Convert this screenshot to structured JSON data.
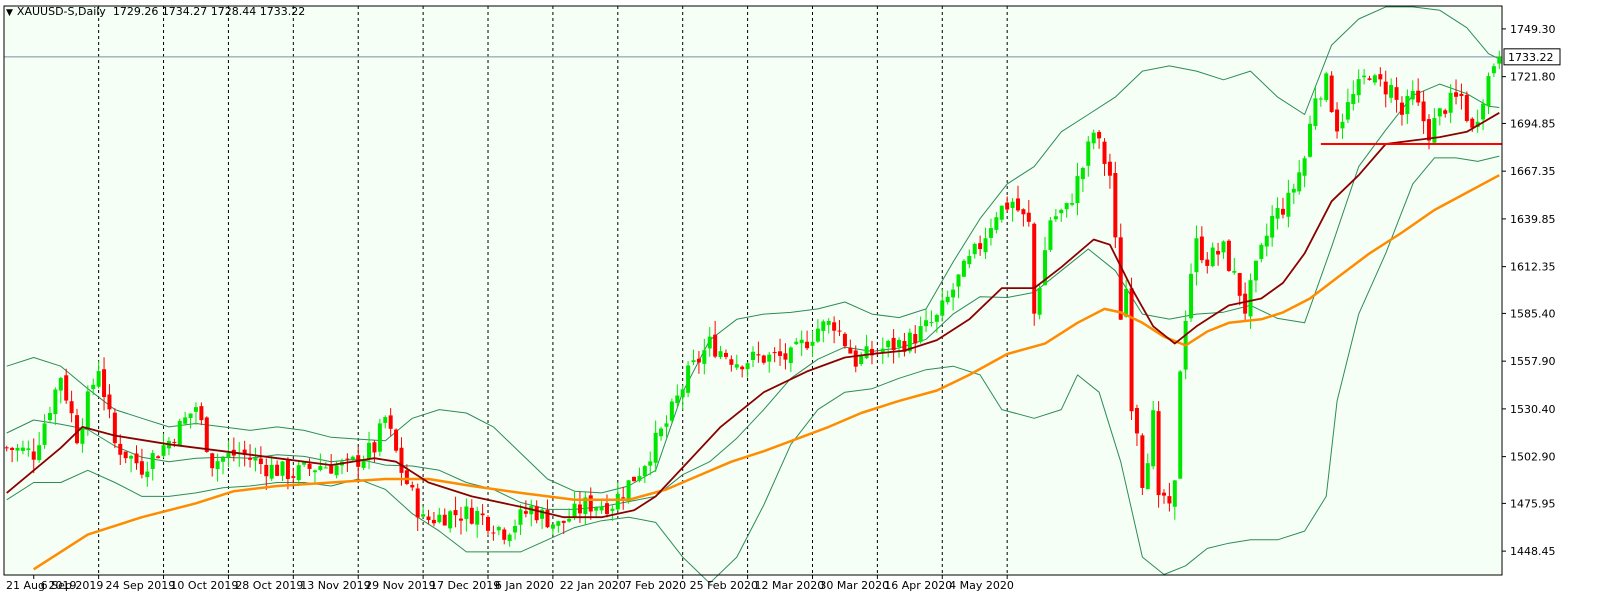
{
  "header": {
    "symbol": "XAUUSD-S,Daily",
    "ohlc": "1729.26 1734.27 1728.44 1733.22"
  },
  "colors": {
    "background": "#f5fff5",
    "bull": "#00e600",
    "bear": "#ff0000",
    "ma_fast": "#8b0000",
    "ma_slow": "#ff8c00",
    "bands": "#2e8b57",
    "grid": "#000000",
    "hline": "#7a8fa8",
    "support": "#ff0000"
  },
  "chart_data": {
    "type": "candlestick",
    "symbol": "XAUUSD-S",
    "timeframe": "Daily",
    "current_price": 1733.22,
    "price_label": "1733.22",
    "ylim": [
      1434.7,
      1762.5
    ],
    "y_ticks": [
      "1749.30",
      "1721.80",
      "1694.85",
      "1667.35",
      "1639.85",
      "1612.35",
      "1585.40",
      "1557.90",
      "1530.40",
      "1502.90",
      "1475.95",
      "1448.45"
    ],
    "x_labels": [
      "21 Aug 2019",
      "6 Sep 2019",
      "24 Sep 2019",
      "10 Oct 2019",
      "28 Oct 2019",
      "13 Nov 2019",
      "29 Nov 2019",
      "17 Dec 2019",
      "6 Jan 2020",
      "22 Jan 2020",
      "7 Feb 2020",
      "25 Feb 2020",
      "12 Mar 2020",
      "30 Mar 2020",
      "16 Apr 2020",
      "4 May 2020"
    ],
    "close_anchors": [
      [
        0,
        1508
      ],
      [
        5,
        1505
      ],
      [
        10,
        1550
      ],
      [
        13,
        1515
      ],
      [
        17,
        1555
      ],
      [
        20,
        1510
      ],
      [
        25,
        1497
      ],
      [
        30,
        1512
      ],
      [
        35,
        1532
      ],
      [
        38,
        1500
      ],
      [
        43,
        1505
      ],
      [
        48,
        1497
      ],
      [
        53,
        1493
      ],
      [
        58,
        1498
      ],
      [
        63,
        1497
      ],
      [
        68,
        1508
      ],
      [
        70,
        1525
      ],
      [
        73,
        1495
      ],
      [
        77,
        1466
      ],
      [
        82,
        1470
      ],
      [
        87,
        1470
      ],
      [
        92,
        1460
      ],
      [
        97,
        1473
      ],
      [
        102,
        1463
      ],
      [
        107,
        1475
      ],
      [
        112,
        1476
      ],
      [
        117,
        1495
      ],
      [
        122,
        1522
      ],
      [
        126,
        1550
      ],
      [
        130,
        1568
      ],
      [
        135,
        1558
      ],
      [
        140,
        1560
      ],
      [
        145,
        1560
      ],
      [
        150,
        1577
      ],
      [
        153,
        1580
      ],
      [
        157,
        1558
      ],
      [
        162,
        1565
      ],
      [
        167,
        1570
      ],
      [
        172,
        1582
      ],
      [
        176,
        1605
      ],
      [
        180,
        1625
      ],
      [
        183,
        1644
      ],
      [
        186,
        1650
      ],
      [
        188,
        1640
      ],
      [
        189,
        1636
      ],
      [
        190,
        1585
      ],
      [
        193,
        1640
      ],
      [
        196,
        1645
      ],
      [
        199,
        1670
      ],
      [
        201,
        1690
      ],
      [
        204,
        1665
      ],
      [
        206,
        1585
      ],
      [
        207,
        1600
      ],
      [
        208,
        1535
      ],
      [
        209,
        1520
      ],
      [
        210,
        1490
      ],
      [
        211,
        1505
      ],
      [
        212,
        1525
      ],
      [
        213,
        1475
      ],
      [
        214,
        1480
      ],
      [
        215,
        1470
      ],
      [
        216,
        1485
      ],
      [
        217,
        1555
      ],
      [
        218,
        1585
      ],
      [
        219,
        1610
      ],
      [
        220,
        1625
      ],
      [
        222,
        1617
      ],
      [
        225,
        1622
      ],
      [
        228,
        1598
      ],
      [
        229,
        1588
      ],
      [
        231,
        1610
      ],
      [
        234,
        1640
      ],
      [
        237,
        1650
      ],
      [
        240,
        1675
      ],
      [
        242,
        1712
      ],
      [
        244,
        1718
      ],
      [
        246,
        1694
      ],
      [
        249,
        1710
      ],
      [
        252,
        1725
      ],
      [
        253,
        1718
      ],
      [
        256,
        1715
      ],
      [
        258,
        1700
      ],
      [
        260,
        1710
      ],
      [
        263,
        1690
      ],
      [
        266,
        1705
      ],
      [
        269,
        1710
      ],
      [
        271,
        1690
      ],
      [
        273,
        1712
      ],
      [
        275,
        1730
      ],
      [
        276,
        1733.22
      ]
    ],
    "ma_fast": [
      [
        0,
        1482
      ],
      [
        10,
        1508
      ],
      [
        14,
        1520
      ],
      [
        20,
        1515
      ],
      [
        30,
        1510
      ],
      [
        40,
        1506
      ],
      [
        50,
        1502
      ],
      [
        60,
        1498
      ],
      [
        68,
        1502
      ],
      [
        72,
        1500
      ],
      [
        78,
        1488
      ],
      [
        86,
        1480
      ],
      [
        95,
        1474
      ],
      [
        103,
        1468
      ],
      [
        110,
        1468
      ],
      [
        116,
        1472
      ],
      [
        120,
        1480
      ],
      [
        126,
        1500
      ],
      [
        132,
        1520
      ],
      [
        140,
        1540
      ],
      [
        148,
        1552
      ],
      [
        155,
        1560
      ],
      [
        160,
        1562
      ],
      [
        166,
        1564
      ],
      [
        172,
        1570
      ],
      [
        178,
        1582
      ],
      [
        184,
        1600
      ],
      [
        190,
        1600
      ],
      [
        195,
        1612
      ],
      [
        201,
        1628
      ],
      [
        204,
        1625
      ],
      [
        208,
        1600
      ],
      [
        212,
        1578
      ],
      [
        216,
        1568
      ],
      [
        220,
        1578
      ],
      [
        226,
        1590
      ],
      [
        232,
        1594
      ],
      [
        236,
        1603
      ],
      [
        240,
        1620
      ],
      [
        245,
        1650
      ],
      [
        250,
        1665
      ],
      [
        255,
        1683
      ],
      [
        260,
        1685
      ],
      [
        265,
        1687
      ],
      [
        270,
        1690
      ],
      [
        276,
        1701
      ]
    ],
    "ma_slow": [
      [
        5,
        1438
      ],
      [
        15,
        1458
      ],
      [
        25,
        1468
      ],
      [
        35,
        1476
      ],
      [
        42,
        1483
      ],
      [
        50,
        1486
      ],
      [
        60,
        1488
      ],
      [
        70,
        1490
      ],
      [
        78,
        1490
      ],
      [
        86,
        1486
      ],
      [
        95,
        1482
      ],
      [
        105,
        1478
      ],
      [
        115,
        1478
      ],
      [
        122,
        1484
      ],
      [
        128,
        1492
      ],
      [
        134,
        1500
      ],
      [
        140,
        1506
      ],
      [
        146,
        1513
      ],
      [
        152,
        1520
      ],
      [
        158,
        1528
      ],
      [
        165,
        1535
      ],
      [
        172,
        1541
      ],
      [
        178,
        1550
      ],
      [
        185,
        1562
      ],
      [
        192,
        1568
      ],
      [
        198,
        1580
      ],
      [
        203,
        1588
      ],
      [
        206,
        1586
      ],
      [
        210,
        1580
      ],
      [
        214,
        1572
      ],
      [
        218,
        1567
      ],
      [
        222,
        1575
      ],
      [
        226,
        1580
      ],
      [
        232,
        1582
      ],
      [
        236,
        1586
      ],
      [
        241,
        1594
      ],
      [
        246,
        1606
      ],
      [
        252,
        1620
      ],
      [
        258,
        1632
      ],
      [
        264,
        1645
      ],
      [
        270,
        1655
      ],
      [
        276,
        1665
      ]
    ],
    "band_upper": [
      [
        0,
        1555
      ],
      [
        5,
        1560
      ],
      [
        10,
        1555
      ],
      [
        15,
        1542
      ],
      [
        20,
        1530
      ],
      [
        25,
        1525
      ],
      [
        30,
        1520
      ],
      [
        35,
        1522
      ],
      [
        40,
        1520
      ],
      [
        45,
        1518
      ],
      [
        50,
        1520
      ],
      [
        55,
        1518
      ],
      [
        60,
        1514
      ],
      [
        65,
        1513
      ],
      [
        70,
        1512
      ],
      [
        75,
        1525
      ],
      [
        80,
        1530
      ],
      [
        85,
        1528
      ],
      [
        90,
        1520
      ],
      [
        95,
        1505
      ],
      [
        100,
        1490
      ],
      [
        105,
        1483
      ],
      [
        110,
        1482
      ],
      [
        115,
        1486
      ],
      [
        120,
        1495
      ],
      [
        125,
        1540
      ],
      [
        130,
        1570
      ],
      [
        135,
        1582
      ],
      [
        140,
        1585
      ],
      [
        145,
        1586
      ],
      [
        150,
        1588
      ],
      [
        155,
        1592
      ],
      [
        160,
        1585
      ],
      [
        165,
        1583
      ],
      [
        170,
        1588
      ],
      [
        175,
        1615
      ],
      [
        180,
        1640
      ],
      [
        185,
        1660
      ],
      [
        190,
        1670
      ],
      [
        195,
        1690
      ],
      [
        200,
        1700
      ],
      [
        205,
        1710
      ],
      [
        210,
        1725
      ],
      [
        215,
        1728
      ],
      [
        220,
        1725
      ],
      [
        225,
        1720
      ],
      [
        230,
        1725
      ],
      [
        235,
        1710
      ],
      [
        240,
        1700
      ],
      [
        245,
        1740
      ],
      [
        250,
        1755
      ],
      [
        255,
        1762
      ],
      [
        260,
        1762
      ],
      [
        265,
        1760
      ],
      [
        270,
        1750
      ],
      [
        274,
        1735
      ],
      [
        276,
        1732
      ]
    ],
    "band_lower": [
      [
        0,
        1478
      ],
      [
        5,
        1488
      ],
      [
        10,
        1488
      ],
      [
        15,
        1495
      ],
      [
        20,
        1488
      ],
      [
        25,
        1480
      ],
      [
        30,
        1480
      ],
      [
        35,
        1482
      ],
      [
        40,
        1485
      ],
      [
        45,
        1486
      ],
      [
        50,
        1488
      ],
      [
        55,
        1488
      ],
      [
        60,
        1486
      ],
      [
        65,
        1490
      ],
      [
        70,
        1484
      ],
      [
        75,
        1470
      ],
      [
        80,
        1460
      ],
      [
        85,
        1448
      ],
      [
        90,
        1448
      ],
      [
        95,
        1448
      ],
      [
        100,
        1455
      ],
      [
        105,
        1462
      ],
      [
        110,
        1466
      ],
      [
        115,
        1468
      ],
      [
        120,
        1465
      ],
      [
        125,
        1445
      ],
      [
        130,
        1430
      ],
      [
        135,
        1445
      ],
      [
        140,
        1475
      ],
      [
        145,
        1510
      ],
      [
        150,
        1530
      ],
      [
        155,
        1540
      ],
      [
        160,
        1542
      ],
      [
        165,
        1548
      ],
      [
        170,
        1553
      ],
      [
        175,
        1555
      ],
      [
        180,
        1550
      ],
      [
        184,
        1530
      ],
      [
        190,
        1525
      ],
      [
        195,
        1530
      ],
      [
        198,
        1550
      ],
      [
        202,
        1540
      ],
      [
        206,
        1500
      ],
      [
        210,
        1445
      ],
      [
        214,
        1435
      ],
      [
        218,
        1440
      ],
      [
        222,
        1450
      ],
      [
        226,
        1453
      ],
      [
        230,
        1455
      ],
      [
        235,
        1455
      ],
      [
        240,
        1460
      ],
      [
        244,
        1480
      ],
      [
        246,
        1535
      ],
      [
        250,
        1585
      ],
      [
        255,
        1620
      ],
      [
        260,
        1660
      ],
      [
        264,
        1675
      ],
      [
        268,
        1675
      ],
      [
        272,
        1673
      ],
      [
        276,
        1676
      ]
    ],
    "support_line": {
      "y": 1683,
      "x_start": 243,
      "x_end": 276
    },
    "bar_count": 277
  }
}
